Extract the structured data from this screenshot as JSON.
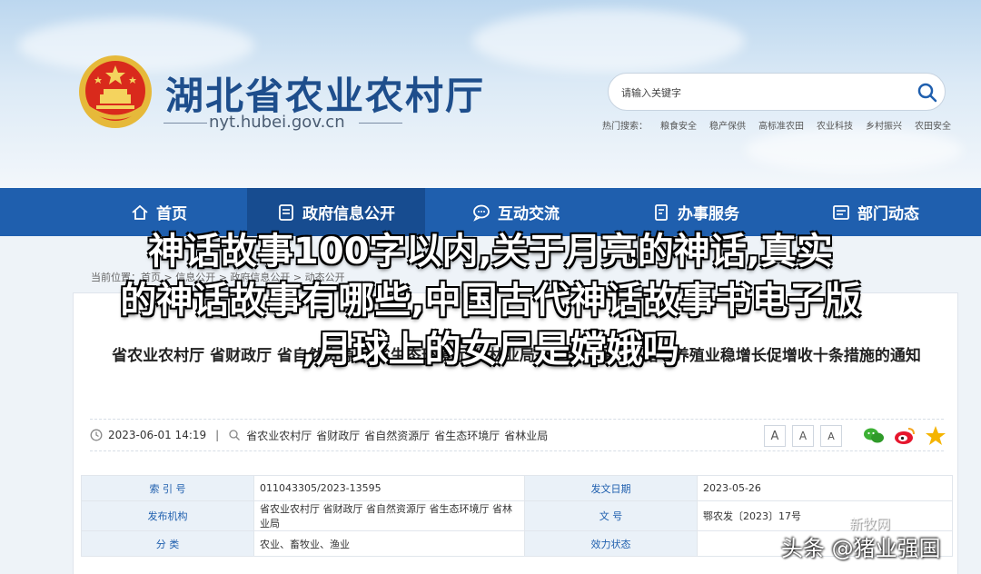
{
  "header": {
    "site_title": "湖北省农业农村厅",
    "domain": "nyt.hubei.gov.cn",
    "search_placeholder": "请输入关键字",
    "hot_label": "热门搜索：",
    "hot_terms": [
      "粮食安全",
      "稳产保供",
      "高标准农田",
      "农业科技",
      "乡村振兴",
      "农田安全"
    ]
  },
  "nav": {
    "items": [
      {
        "label": "首页",
        "icon": "home-icon"
      },
      {
        "label": "政府信息公开",
        "icon": "document-list-icon"
      },
      {
        "label": "互动交流",
        "icon": "chat-icon"
      },
      {
        "label": "办事服务",
        "icon": "service-icon"
      },
      {
        "label": "部门动态",
        "icon": "dynamics-icon"
      }
    ]
  },
  "breadcrumb": "当前位置：首页 > 信息公开 > 政府信息公开 > 动态公开",
  "article": {
    "title": "省农业农村厅 省财政厅 省自然资源厅 省生态环境厅 省林业局关于印发促进生猪等养殖业稳增长促增收十条措施的通知",
    "date": "2023-06-01 14:19",
    "separator": "|",
    "sources": [
      "省农业农村厅",
      "省财政厅",
      "省自然资源厅",
      "省生态环境厅",
      "省林业局"
    ],
    "font_buttons": [
      "A",
      "A",
      "A"
    ]
  },
  "info_table": {
    "rows": [
      {
        "l1": "索  引  号",
        "v1": "011043305/2023-13595",
        "l2": "发文日期",
        "v2": "2023-05-26"
      },
      {
        "l1": "发布机构",
        "v1": "省农业农村厅 省财政厅 省自然资源厅 省生态环境厅 省林业局",
        "l2": "文        号",
        "v2": "鄂农发〔2023〕17号"
      },
      {
        "l1": "分        类",
        "v1": "农业、畜牧业、渔业",
        "l2": "效力状态",
        "v2": ""
      }
    ]
  },
  "overlay": {
    "line1": "神话故事100字以内,关于月亮的神话,真实",
    "line2": "的神话故事有哪些,中国古代神话故事书电子版",
    "line3": ",月球上的女尸是嫦娥吗"
  },
  "watermark": {
    "text": "头条 @猪业强国",
    "brand": "新牧网"
  },
  "colors": {
    "nav_bg": "#1f5fae",
    "title_blue": "#1e4e8c",
    "label_bg": "#eaf1f8"
  }
}
